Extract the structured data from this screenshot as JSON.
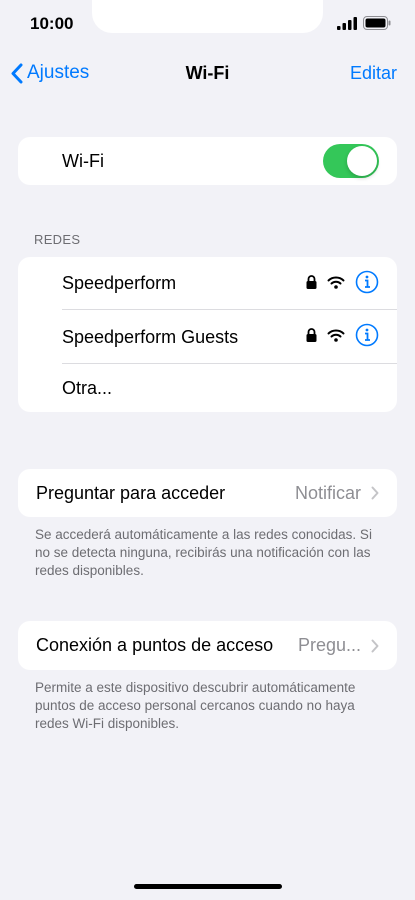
{
  "status_bar": {
    "time": "10:00"
  },
  "nav": {
    "back_label": "Ajustes",
    "title": "Wi-Fi",
    "edit_label": "Editar"
  },
  "wifi_toggle": {
    "label": "Wi-Fi",
    "enabled": true
  },
  "networks": {
    "header": "REDES",
    "items": [
      {
        "name": "Speedperform",
        "secured": true
      },
      {
        "name": "Speedperform Guests",
        "secured": true
      }
    ],
    "other_label": "Otra..."
  },
  "ask_to_join": {
    "label": "Preguntar para acceder",
    "value": "Notificar",
    "footer": "Se accederá automáticamente a las redes conocidas. Si no se detecta ninguna, recibirás una notificación con las redes disponibles."
  },
  "hotspot": {
    "label": "Conexión a puntos de acceso",
    "value": "Pregu...",
    "footer": "Permite a este dispositivo descubrir automáticamente puntos de acceso personal cercanos cuando no haya redes Wi-Fi disponibles."
  },
  "colors": {
    "accent": "#007aff",
    "toggle_on": "#34c759",
    "background": "#f2f2f7"
  }
}
